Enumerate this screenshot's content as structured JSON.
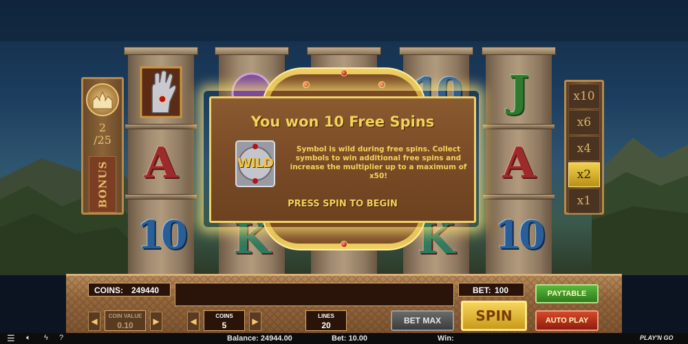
{
  "bonus": {
    "count_line1": "2",
    "count_line2": "/25",
    "label": "BONUS"
  },
  "multipliers": [
    {
      "label": "x10",
      "active": false
    },
    {
      "label": "x6",
      "active": false
    },
    {
      "label": "x4",
      "active": false
    },
    {
      "label": "x2",
      "active": true
    },
    {
      "label": "x1",
      "active": false
    }
  ],
  "reels": [
    {
      "symbols": [
        "palm-hand",
        "A",
        "10"
      ]
    },
    {
      "symbols": [
        "purple-gem",
        "",
        "K"
      ]
    },
    {
      "symbols": [
        "",
        "",
        ""
      ]
    },
    {
      "symbols": [
        "10",
        "",
        "K"
      ]
    },
    {
      "symbols": [
        "J",
        "A",
        "10"
      ]
    }
  ],
  "popup": {
    "title": "You won 10 Free Spins",
    "wild_label": "WILD",
    "description": "Symbol is wild during free spins. Collect symbols to win additional free spins and increase the multiplier up to a maximum of x50!",
    "cta": "PRESS SPIN TO BEGIN"
  },
  "controls": {
    "coins_label": "COINS:",
    "coins_value": "249440",
    "bet_label": "BET:",
    "bet_value": "100",
    "coin_value_label": "COIN VALUE",
    "coin_value": "0.10",
    "coins_bet_label": "COINS",
    "coins_bet_value": "5",
    "lines_label": "LINES",
    "lines_value": "20",
    "bet_max": "BET MAX",
    "spin": "SPIN",
    "paytable": "PAYTABLE",
    "auto_play": "AUTO PLAY"
  },
  "status": {
    "balance_label": "Balance:",
    "balance_value": "24944.00",
    "bet_label": "Bet:",
    "bet_value": "10.00",
    "win_label": "Win:",
    "win_value": "",
    "brand": "PLAY'N GO"
  },
  "colors": {
    "gold": "#f5d25a",
    "active_multiplier": "#f2d24a",
    "paytable_green": "#3c9a2a",
    "autoplay_red": "#b52c1a"
  }
}
